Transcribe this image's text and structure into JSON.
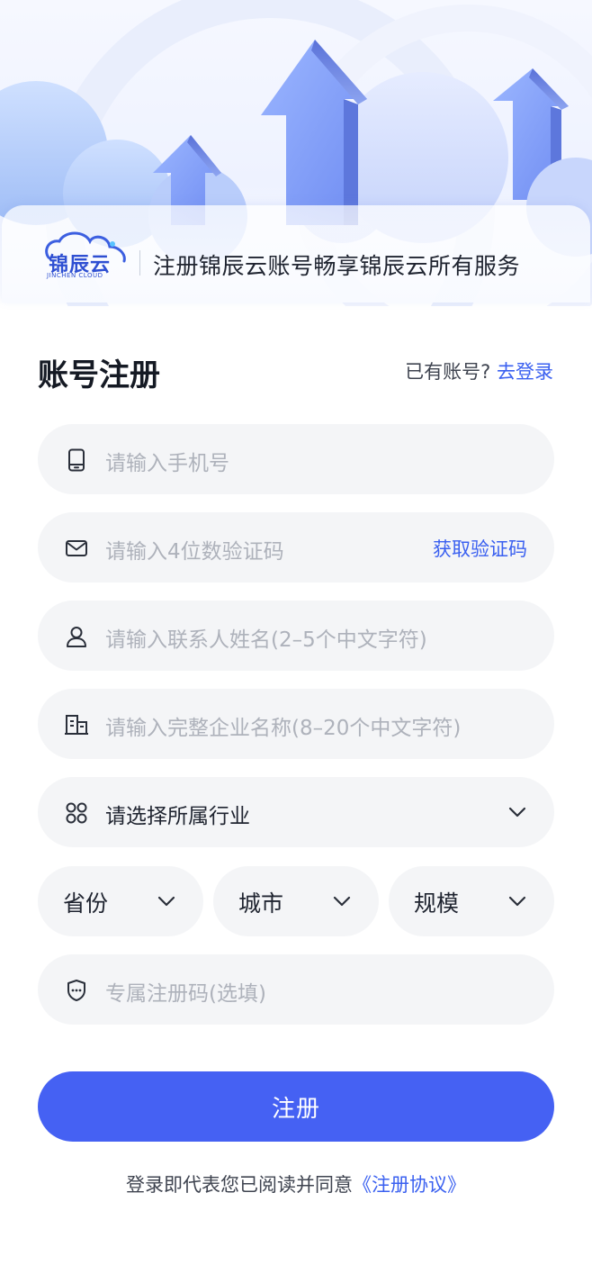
{
  "header": {
    "brand_name": "锦辰云",
    "brand_sub": "JINCHEN CLOUD",
    "tagline": "注册锦辰云账号畅享锦辰云所有服务"
  },
  "title": "账号注册",
  "login_prompt": {
    "text": "已有账号?",
    "link": "去登录"
  },
  "fields": {
    "phone": {
      "placeholder": "请输入手机号",
      "icon": "phone-icon"
    },
    "code": {
      "placeholder": "请输入4位数验证码",
      "icon": "mail-icon",
      "action": "获取验证码"
    },
    "name": {
      "placeholder": "请输入联系人姓名(2–5个中文字符)",
      "icon": "user-icon"
    },
    "company": {
      "placeholder": "请输入完整企业名称(8–20个中文字符)",
      "icon": "building-icon"
    },
    "industry": {
      "value": "请选择所属行业",
      "icon": "apps-icon"
    },
    "province": {
      "value": "省份"
    },
    "city": {
      "value": "城市"
    },
    "scale": {
      "value": "规模"
    },
    "invite": {
      "placeholder": "专属注册码(选填)",
      "icon": "shield-icon"
    }
  },
  "submit_label": "注册",
  "agreement": {
    "text": "登录即代表您已阅读并同意",
    "link": "《注册协议》"
  },
  "colors": {
    "primary": "#4561F3",
    "link": "#3A60F0",
    "field_bg": "#F4F5F7"
  }
}
